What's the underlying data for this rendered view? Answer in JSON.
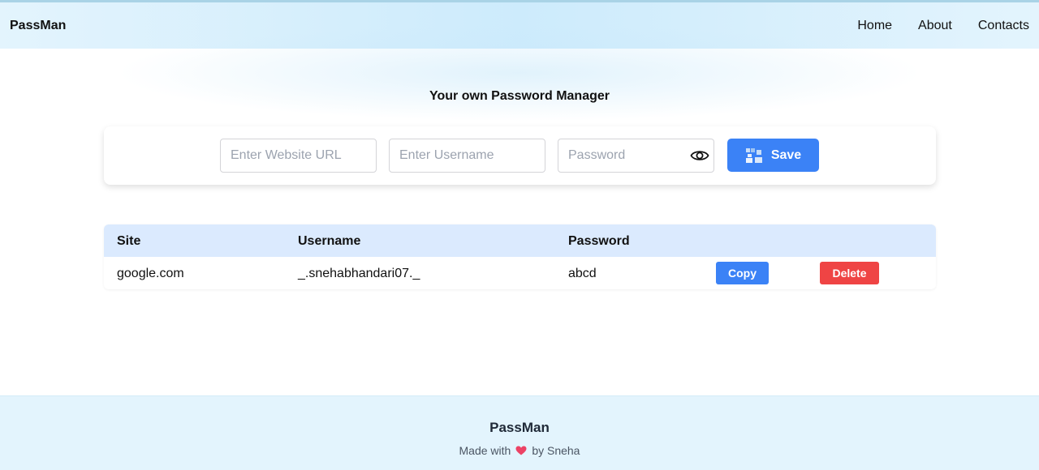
{
  "navbar": {
    "brand": "PassMan",
    "links": [
      "Home",
      "About",
      "Contacts"
    ]
  },
  "main": {
    "title": "Your own Password Manager",
    "form": {
      "url_placeholder": "Enter Website URL",
      "username_placeholder": "Enter Username",
      "password_placeholder": "Password",
      "save_label": "Save"
    }
  },
  "table": {
    "headers": [
      "Site",
      "Username",
      "Password"
    ],
    "rows": [
      {
        "site": "google.com",
        "username": "_.snehabhandari07._",
        "password": "abcd",
        "copy_label": "Copy",
        "delete_label": "Delete"
      }
    ]
  },
  "footer": {
    "brand": "PassMan",
    "made_with": "Made with",
    "by": "by Sneha"
  },
  "colors": {
    "accent": "#3b82f6",
    "danger": "#ef4444",
    "table_header": "#dbeafe",
    "nav_bg": "#cdebfc",
    "footer_bg": "#e3f4fd"
  },
  "icons": [
    "eye-icon",
    "save-icon",
    "heart-icon"
  ]
}
